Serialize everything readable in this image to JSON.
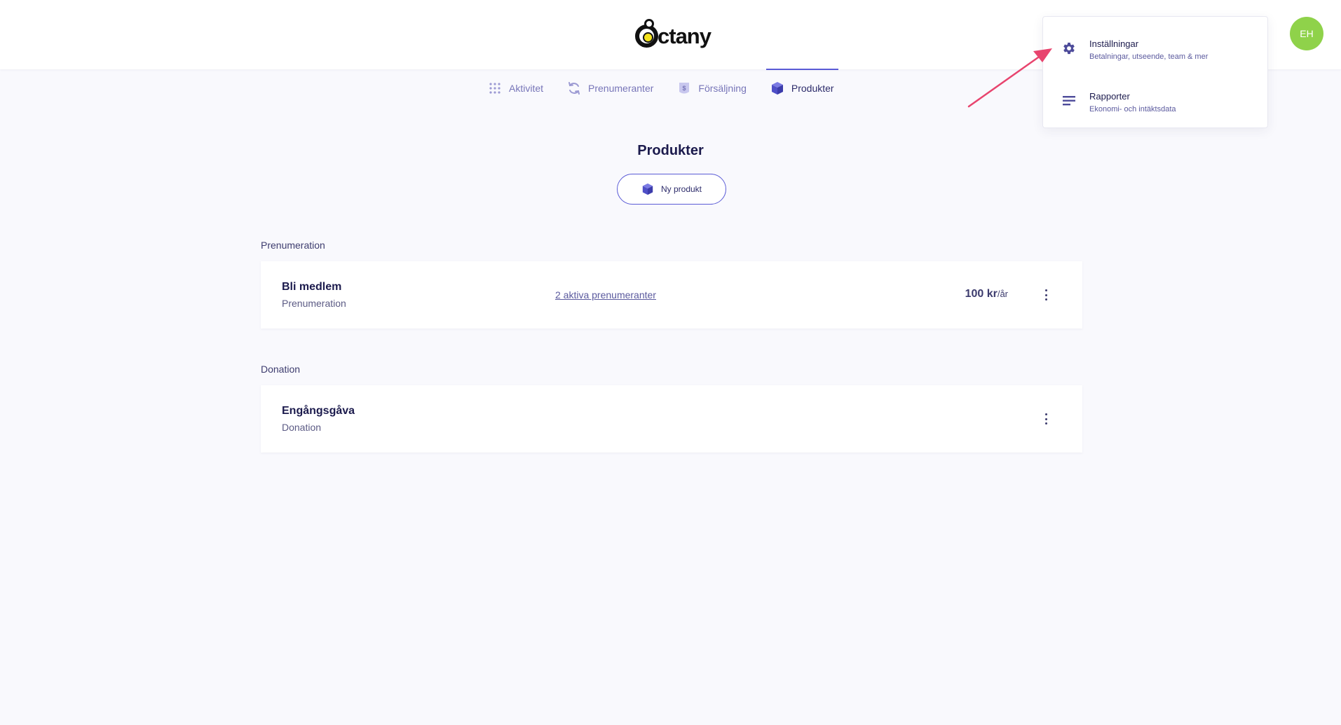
{
  "header": {
    "logo_text": "ctany",
    "avatar_initials": "EH"
  },
  "tabs": [
    {
      "label": "Aktivitet",
      "icon": "grid-icon"
    },
    {
      "label": "Prenumeranter",
      "icon": "refresh-icon"
    },
    {
      "label": "Försäljning",
      "icon": "receipt-icon"
    },
    {
      "label": "Produkter",
      "icon": "box-icon",
      "active": true
    }
  ],
  "main": {
    "title": "Produkter",
    "new_product_label": "Ny produkt"
  },
  "sections": [
    {
      "label": "Prenumeration",
      "products": [
        {
          "name": "Bli medlem",
          "type": "Prenumeration",
          "subscribers_link": "2 aktiva prenumeranter",
          "price": "100 kr",
          "price_unit": "/år"
        }
      ]
    },
    {
      "label": "Donation",
      "products": [
        {
          "name": "Engångsgåva",
          "type": "Donation"
        }
      ]
    }
  ],
  "dropdown": {
    "items": [
      {
        "title": "Inställningar",
        "subtitle": "Betalningar, utseende, team & mer",
        "icon": "gear-icon"
      },
      {
        "title": "Rapporter",
        "subtitle": "Ekonomi- och intäktsdata",
        "icon": "lines-icon"
      }
    ]
  },
  "colors": {
    "accent": "#5a5bd6",
    "text_dark": "#1c1b4d",
    "tab_inactive": "#7775b8",
    "avatar_bg": "#8fd24a",
    "annotation_arrow": "#e8446e",
    "page_bg": "#f9f9fd"
  }
}
